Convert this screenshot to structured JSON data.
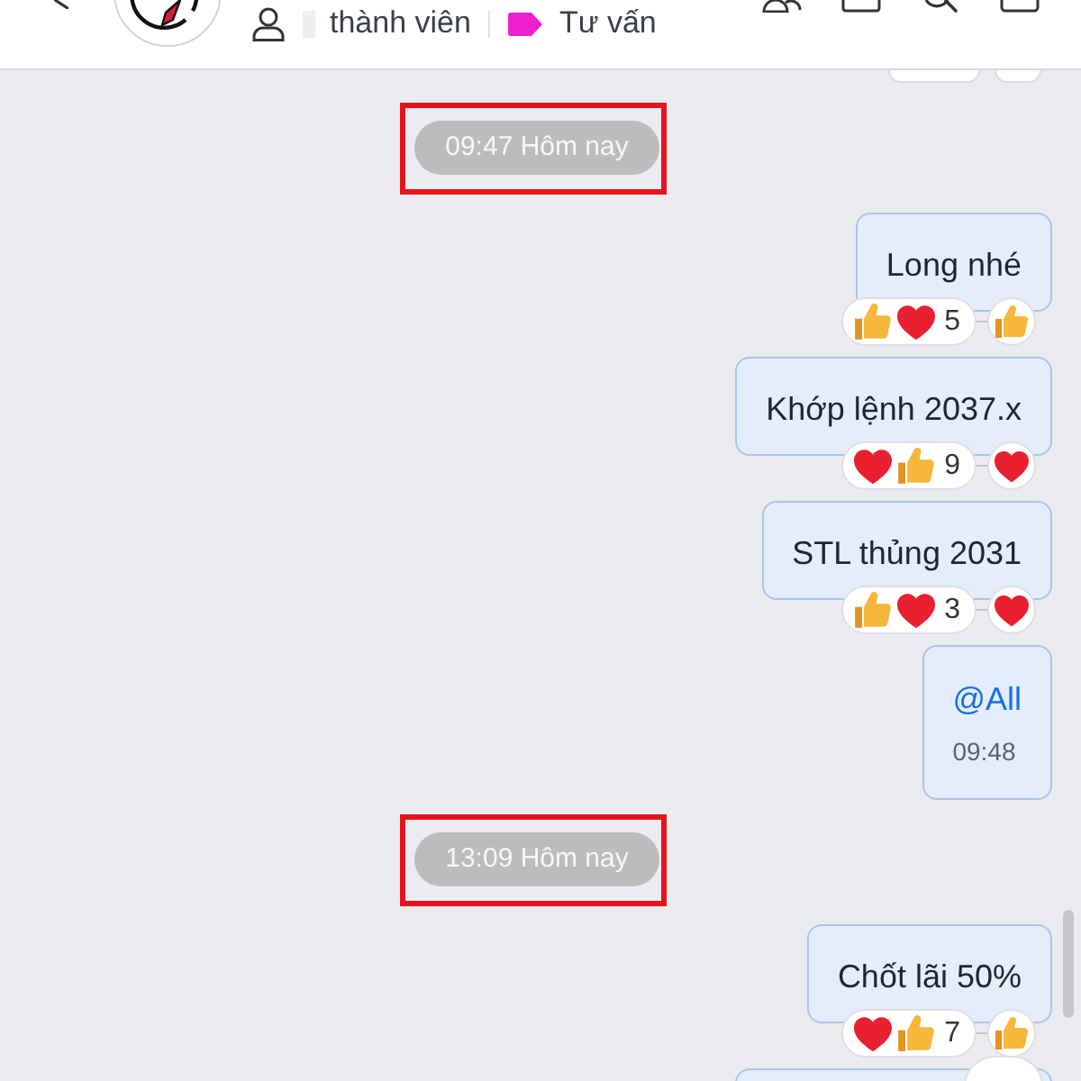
{
  "header": {
    "member_label": "thành viên",
    "tag_label": "Tư vấn"
  },
  "chat": {
    "items": [
      {
        "kind": "reactions_cut"
      },
      {
        "kind": "time_separator",
        "text": "09:47 Hôm nay",
        "highlighted": true
      },
      {
        "kind": "text",
        "text": "Long nhé",
        "reactions": [
          {
            "kind": "like"
          },
          {
            "kind": "heart"
          }
        ],
        "reaction_count": "5",
        "my_reaction": {
          "kind": "like"
        }
      },
      {
        "kind": "text",
        "text": "Khớp lệnh 2037.x",
        "reactions": [
          {
            "kind": "heart"
          },
          {
            "kind": "like"
          }
        ],
        "reaction_count": "9",
        "my_reaction": {
          "kind": "heart"
        }
      },
      {
        "kind": "text",
        "text": "STL thủng 2031",
        "reactions": [
          {
            "kind": "like"
          },
          {
            "kind": "heart"
          }
        ],
        "reaction_count": "3",
        "my_reaction": {
          "kind": "heart"
        }
      },
      {
        "kind": "mention",
        "text": "@All",
        "time": "09:48"
      },
      {
        "kind": "time_separator",
        "text": "13:09 Hôm nay",
        "highlighted": true
      },
      {
        "kind": "text",
        "text": "Chốt lãi 50%",
        "reactions": [
          {
            "kind": "heart"
          },
          {
            "kind": "like"
          }
        ],
        "reaction_count": "7",
        "my_reaction": {
          "kind": "like"
        }
      },
      {
        "kind": "bubble_cut"
      }
    ]
  }
}
